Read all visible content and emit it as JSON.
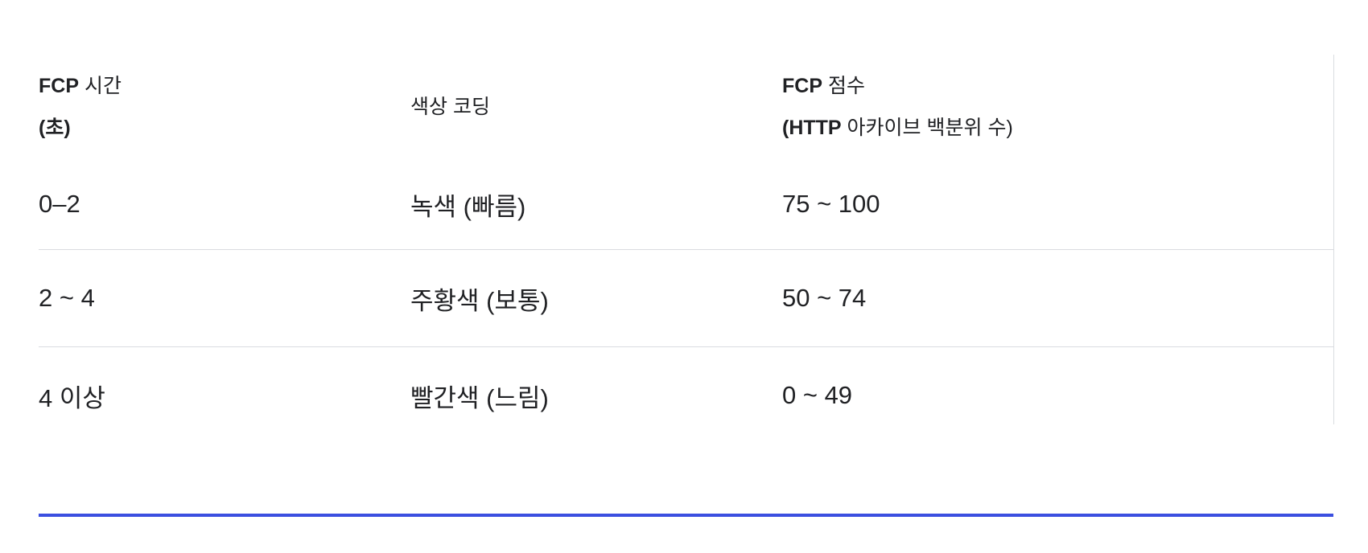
{
  "table": {
    "headers": {
      "col1_line1_bold": "FCP",
      "col1_line1_rest": " 시간",
      "col1_line2": "(초)",
      "col2": "색상 코딩",
      "col3_line1_bold": "FCP",
      "col3_line1_rest": " 점수",
      "col3_line2_open": "(",
      "col3_line2_bold": "HTTP",
      "col3_line2_rest": " 아카이브 백분위 수)"
    },
    "rows": [
      {
        "time": "0–2",
        "color": "녹색 (빠름)",
        "score": "75 ~ 100"
      },
      {
        "time": "2 ~ 4",
        "color": "주황색 (보통)",
        "score": "50 ~ 74"
      },
      {
        "time": "4 이상",
        "color": "빨간색 (느림)",
        "score": "0 ~ 49"
      }
    ]
  },
  "colors": {
    "accent_rule": "#3b4fe0",
    "row_divider": "#dadce0",
    "text": "#202124"
  }
}
